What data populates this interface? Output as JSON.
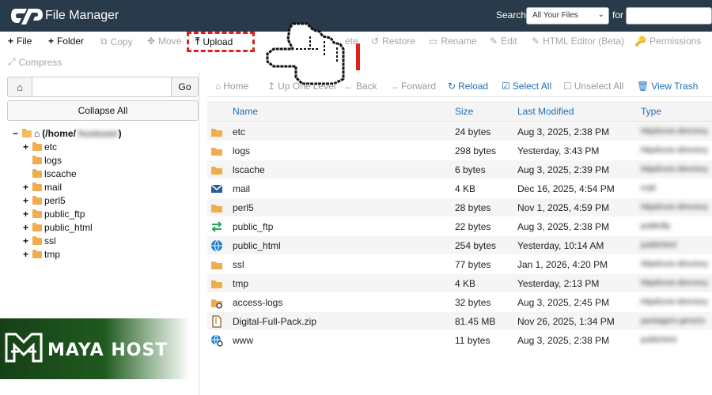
{
  "app": {
    "title": "File Manager"
  },
  "search": {
    "label": "Search",
    "scope": "All Your Files",
    "for_label": "for",
    "value": ""
  },
  "toolbar": {
    "file": "File",
    "folder": "Folder",
    "copy": "Copy",
    "move": "Move",
    "upload": "Upload",
    "delete_fragment": "ete",
    "restore": "Restore",
    "rename": "Rename",
    "edit": "Edit",
    "html_editor": "HTML Editor (Beta)",
    "permissions": "Permissions",
    "compress": "Compress"
  },
  "left": {
    "go": "Go",
    "path_value": "",
    "collapse_all": "Collapse All",
    "tree": [
      {
        "label": "(/home/",
        "suffix": "hostuser",
        "end": ")",
        "toggle": "−",
        "expanded": true
      },
      {
        "label": "etc",
        "toggle": "+"
      },
      {
        "label": "logs",
        "toggle": ""
      },
      {
        "label": "lscache",
        "toggle": ""
      },
      {
        "label": "mail",
        "toggle": "+"
      },
      {
        "label": "perl5",
        "toggle": "+"
      },
      {
        "label": "public_ftp",
        "toggle": "+"
      },
      {
        "label": "public_html",
        "toggle": "+"
      },
      {
        "label": "ssl",
        "toggle": "+"
      },
      {
        "label": "tmp",
        "toggle": "+"
      }
    ]
  },
  "nav": {
    "home": "Home",
    "up": "Up One Level",
    "back": "Back",
    "forward": "Forward",
    "reload": "Reload",
    "select_all": "Select All",
    "unselect_all": "Unselect All",
    "view_trash": "View Trash"
  },
  "table": {
    "columns": [
      "Name",
      "Size",
      "Last Modified",
      "Type"
    ],
    "rows": [
      {
        "name": "etc",
        "size": "24 bytes",
        "modified": "Aug 3, 2025, 2:38 PM",
        "type": "httpd/unix-directory",
        "icon": "folder-icon"
      },
      {
        "name": "logs",
        "size": "298 bytes",
        "modified": "Yesterday, 3:43 PM",
        "type": "httpd/unix-directory",
        "icon": "folder-icon"
      },
      {
        "name": "lscache",
        "size": "6 bytes",
        "modified": "Aug 3, 2025, 2:39 PM",
        "type": "httpd/unix-directory",
        "icon": "folder-icon"
      },
      {
        "name": "mail",
        "size": "4 KB",
        "modified": "Dec 16, 2025, 4:54 PM",
        "type": "mail",
        "icon": "mail-icon"
      },
      {
        "name": "perl5",
        "size": "28 bytes",
        "modified": "Nov 1, 2025, 4:59 PM",
        "type": "httpd/unix-directory",
        "icon": "folder-icon"
      },
      {
        "name": "public_ftp",
        "size": "22 bytes",
        "modified": "Aug 3, 2025, 2:38 PM",
        "type": "publicftp",
        "icon": "transfer-icon"
      },
      {
        "name": "public_html",
        "size": "254 bytes",
        "modified": "Yesterday, 10:14 AM",
        "type": "publichtml",
        "icon": "globe-icon"
      },
      {
        "name": "ssl",
        "size": "77 bytes",
        "modified": "Jan 1, 2026, 4:20 PM",
        "type": "httpd/unix-directory",
        "icon": "folder-icon"
      },
      {
        "name": "tmp",
        "size": "4 KB",
        "modified": "Yesterday, 2:13 PM",
        "type": "httpd/unix-directory",
        "icon": "folder-icon"
      },
      {
        "name": "access-logs",
        "size": "32 bytes",
        "modified": "Aug 3, 2025, 2:45 PM",
        "type": "httpd/unix-directory",
        "icon": "folder-link-icon"
      },
      {
        "name": "Digital-Full-Pack.zip",
        "size": "81.45 MB",
        "modified": "Nov 26, 2025, 1:34 PM",
        "type": "package/x-generic",
        "icon": "zip-icon"
      },
      {
        "name": "www",
        "size": "11 bytes",
        "modified": "Aug 3, 2025, 2:38 PM",
        "type": "publichtml",
        "icon": "globe-link-icon"
      }
    ]
  },
  "watermark": {
    "text": "MAYA HOST"
  },
  "colors": {
    "topbar": "#293a4a",
    "link": "#1f6fb7",
    "folder": "#f0ad4e",
    "highlight": "#e02020",
    "watermark": "#1f5a1f"
  }
}
